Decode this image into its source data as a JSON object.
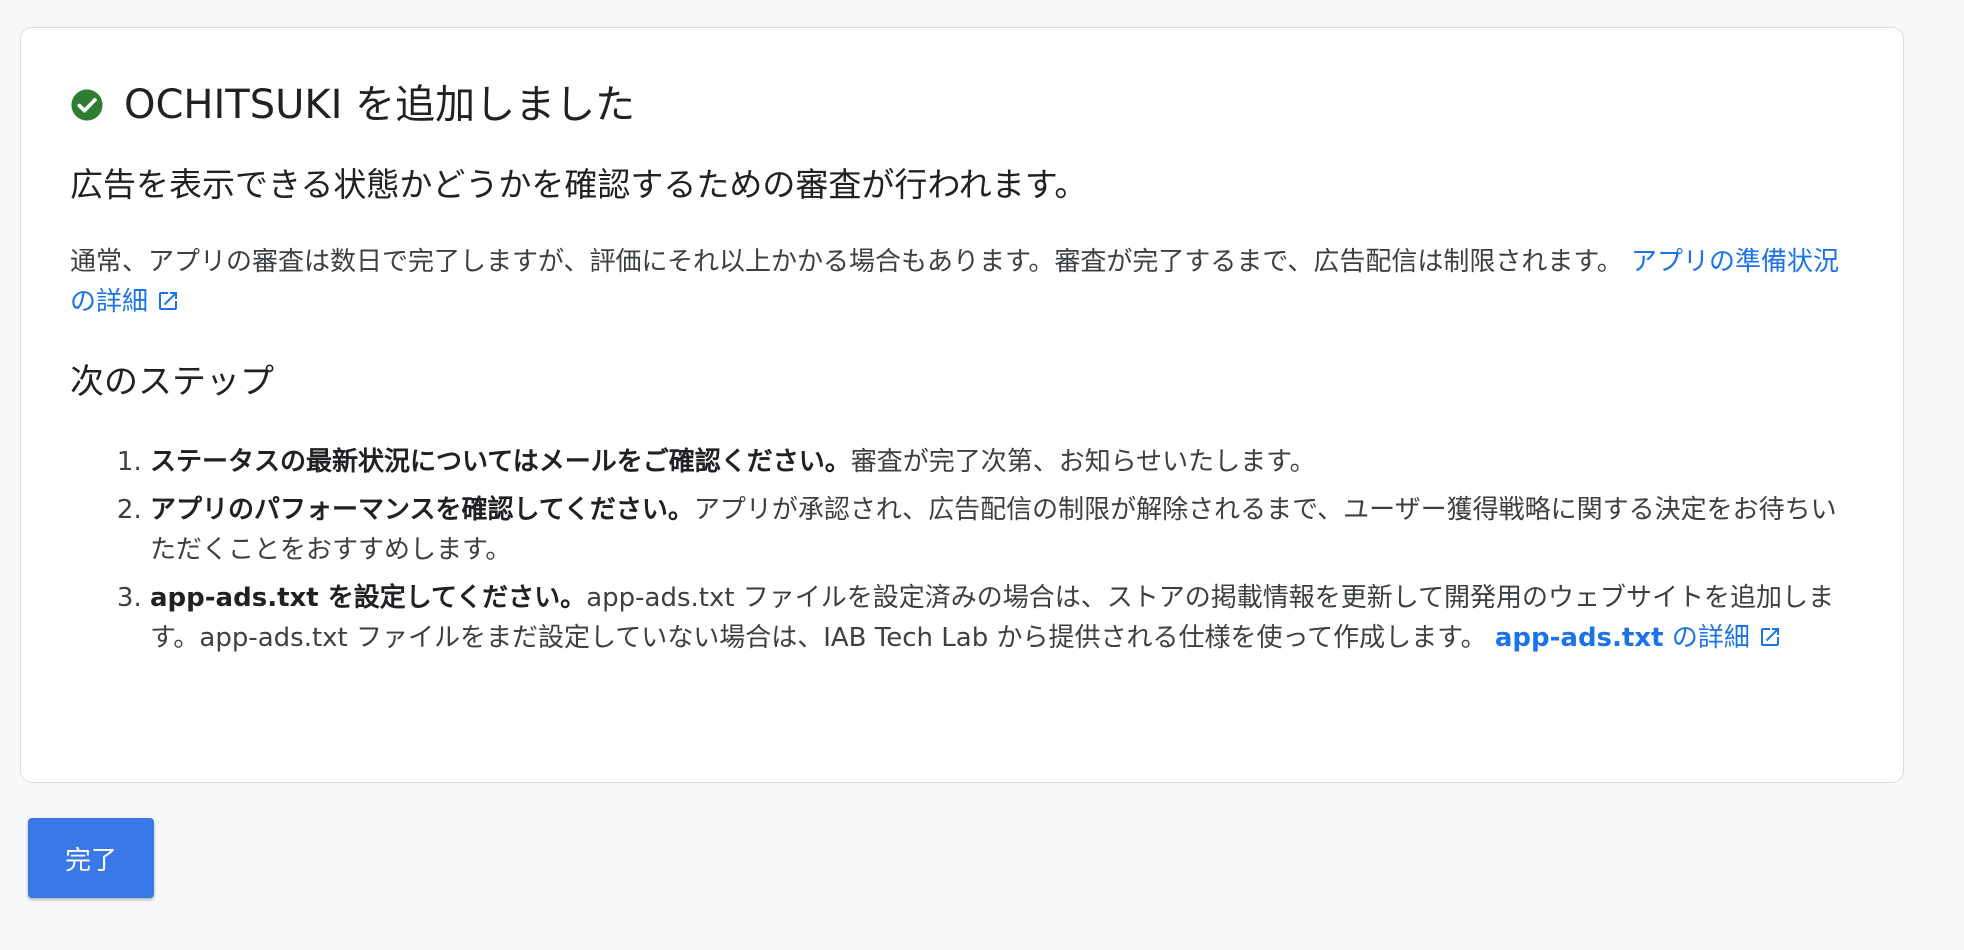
{
  "colors": {
    "accent": "#1a73e8",
    "button": "#3b78e7",
    "success": "#2e7d32"
  },
  "header": {
    "icon": "check-circle-icon",
    "title": "OCHITSUKI を追加しました"
  },
  "subtitle": "広告を表示できる状態かどうかを確認するための審査が行われます。",
  "intro": {
    "text": "通常、アプリの審査は数日で完了しますが、評価にそれ以上かかる場合もあります。審査が完了するまで、広告配信は制限されます。",
    "link_label": "アプリの準備状況の詳細",
    "link_icon": "external-link-icon"
  },
  "next_steps": {
    "title": "次のステップ",
    "items": [
      {
        "bold": "ステータスの最新状況についてはメールをご確認ください。",
        "text": "審査が完了次第、お知らせいたします。"
      },
      {
        "bold": "アプリのパフォーマンスを確認してください。",
        "text": "アプリが承認され、広告配信の制限が解除されるまで、ユーザー獲得戦略に関する決定をお待ちいただくことをおすすめします。"
      },
      {
        "bold": "app-ads.txt を設定してください。",
        "text": "app-ads.txt ファイルを設定済みの場合は、ストアの掲載情報を更新して開発用のウェブサイトを追加します。app-ads.txt ファイルをまだ設定していない場合は、IAB Tech Lab から提供される仕様を使って作成します。",
        "link_bold": "app-ads.txt",
        "link_rest": "の詳細"
      }
    ]
  },
  "done_button": {
    "label": "完了"
  }
}
